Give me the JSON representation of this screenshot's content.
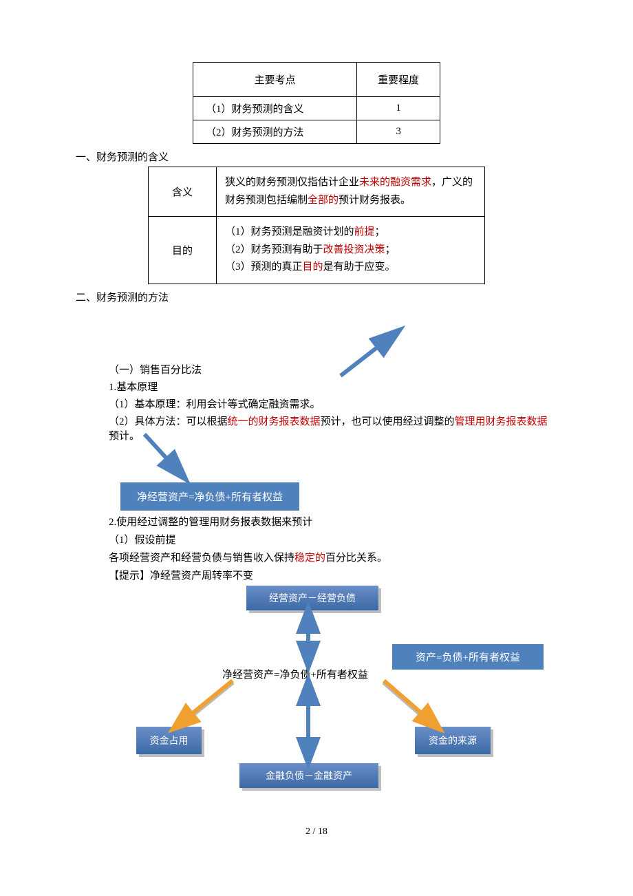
{
  "table1": {
    "headers": [
      "主要考点",
      "重要程度"
    ],
    "rows": [
      {
        "name": "（1）财务预测的含义",
        "level": "1"
      },
      {
        "name": "（2）财务预测的方法",
        "level": "3"
      }
    ]
  },
  "section1": {
    "title": "一、财务预测的含义",
    "meaning_label": "含义",
    "meaning_text_pre": "狭义的财务预测仅指估计企业",
    "meaning_red1": "未来的融资需求",
    "meaning_text_mid": "，广义的财务预测包括编制",
    "meaning_red2": "全部的",
    "meaning_text_post": "预计财务报表。",
    "purpose_label": "目的",
    "purpose_1_pre": "（1）财务预测是融资计划的",
    "purpose_1_red": "前提",
    "purpose_1_post": "；",
    "purpose_2_pre": "（2）财务预测有助于",
    "purpose_2_red": "改善投资决策",
    "purpose_2_post": "；",
    "purpose_3_pre": "（3）预测的真正",
    "purpose_3_red": "目的",
    "purpose_3_post": "是有助于应变。"
  },
  "section2": {
    "title": "二、财务预测的方法",
    "top_equation": "资产=负债+所有者权益",
    "sub1": "（一）销售百分比法",
    "sub1_1": "1.基本原理",
    "sub1_1_1": "（1）基本原理：利用会计等式确定融资需求。",
    "sub1_1_2_pre": "（2）具体方法：可以根据",
    "sub1_1_2_red1": "统一的财务报表数据",
    "sub1_1_2_mid": "预计，也可以使用经过调整的",
    "sub1_1_2_red2": "管理用财务报表数据",
    "sub1_1_2_post": "预计。",
    "bot_equation": "净经营资产=净负债+所有者权益",
    "sub1_2": "2.使用经过调整的管理用财务报表数据来预计",
    "sub1_2_1": "（1）假设前提",
    "sub1_2_line_pre": "各项经营资产和经营负债与销售收入保持",
    "sub1_2_line_red": "稳定的",
    "sub1_2_line_post": "百分比关系。",
    "sub1_2_tip": "【提示】净经营资产周转率不变"
  },
  "diagram": {
    "top": "经营资产－经营负债",
    "mid": "净经营资产=净负债+所有者权益",
    "left": "资金占用",
    "right": "资金的来源",
    "bottom": "金融负债－金融资产"
  },
  "pagenum": "2 / 18"
}
